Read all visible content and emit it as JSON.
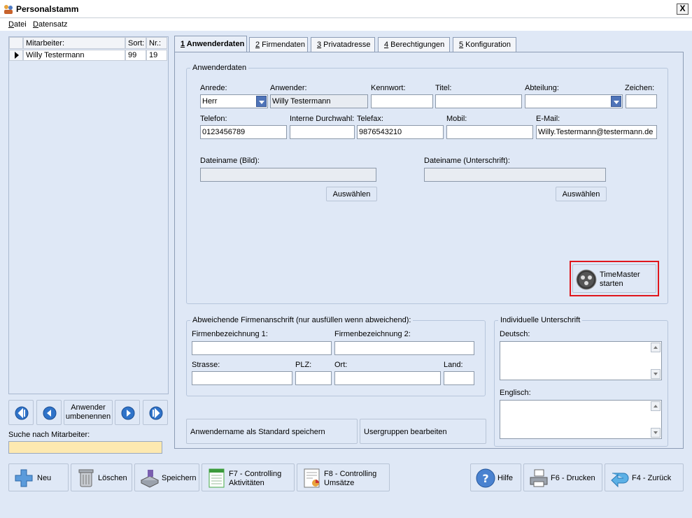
{
  "window": {
    "title": "Personalstamm",
    "close_label": "X"
  },
  "menu": [
    "Datei",
    "Datensatz"
  ],
  "employee_grid": {
    "columns": [
      "Mitarbeiter:",
      "Sort:",
      "Nr.:"
    ],
    "rows": [
      {
        "name": "Willy Testermann",
        "sort": "99",
        "nr": "19"
      }
    ]
  },
  "nav": {
    "rename_line1": "Anwender",
    "rename_line2": "umbenennen"
  },
  "search": {
    "label": "Suche nach Mitarbeiter:",
    "value": ""
  },
  "tabs": [
    {
      "num": "1",
      "label": " Anwenderdaten"
    },
    {
      "num": "2",
      "label": " Firmendaten"
    },
    {
      "num": "3",
      "label": " Privatadresse"
    },
    {
      "num": "4",
      "label": " Berechtigungen"
    },
    {
      "num": "5",
      "label": " Konfiguration"
    }
  ],
  "anwenderdaten": {
    "group_title": "Anwenderdaten",
    "anrede_label": "Anrede:",
    "anrede_value": "Herr",
    "anwender_label": "Anwender:",
    "anwender_value": "Willy Testermann",
    "kennwort_label": "Kennwort:",
    "titel_label": "Titel:",
    "abteilung_label": "Abteilung:",
    "zeichen_label": "Zeichen:",
    "telefon_label": "Telefon:",
    "telefon_value": "0123456789",
    "durchwahl_label": "Interne Durchwahl:",
    "telefax_label": "Telefax:",
    "telefax_value": "9876543210",
    "mobil_label": "Mobil:",
    "email_label": "E-Mail:",
    "email_value": "Willy.Testermann@testermann.de",
    "bild_label": "Dateiname (Bild):",
    "unterschrift_label": "Dateiname (Unterschrift):",
    "auswaehlen": "Auswählen",
    "timemaster_line1": "TimeMaster",
    "timemaster_line2": "starten"
  },
  "firmenanschrift": {
    "group_title": "Abweichende Firmenanschrift (nur ausfüllen wenn abweichend):",
    "bez1_label": "Firmenbezeichnung 1:",
    "bez2_label": "Firmenbezeichnung 2:",
    "strasse_label": "Strasse:",
    "plz_label": "PLZ:",
    "ort_label": "Ort:",
    "land_label": "Land:"
  },
  "unterschrift": {
    "group_title": "Individuelle Unterschrift",
    "deutsch_label": "Deutsch:",
    "englisch_label": "Englisch:"
  },
  "actions": {
    "save_standard": "Anwendername als Standard speichern",
    "usergroups": "Usergruppen bearbeiten"
  },
  "bottom_buttons": {
    "neu": "Neu",
    "loeschen": "Löschen",
    "speichern": "Speichern",
    "f7_line1": "F7 - Controlling",
    "f7_line2": "Aktivitäten",
    "f8_line1": "F8 - Controlling",
    "f8_line2": "Umsätze",
    "hilfe": "Hilfe",
    "drucken": "F6 - Drucken",
    "zurueck": "F4 - Zurück"
  },
  "colors": {
    "highlight_border": "#e0161c",
    "search_bg": "#fde9b0",
    "dropdown_blue": "#4f74b8"
  }
}
